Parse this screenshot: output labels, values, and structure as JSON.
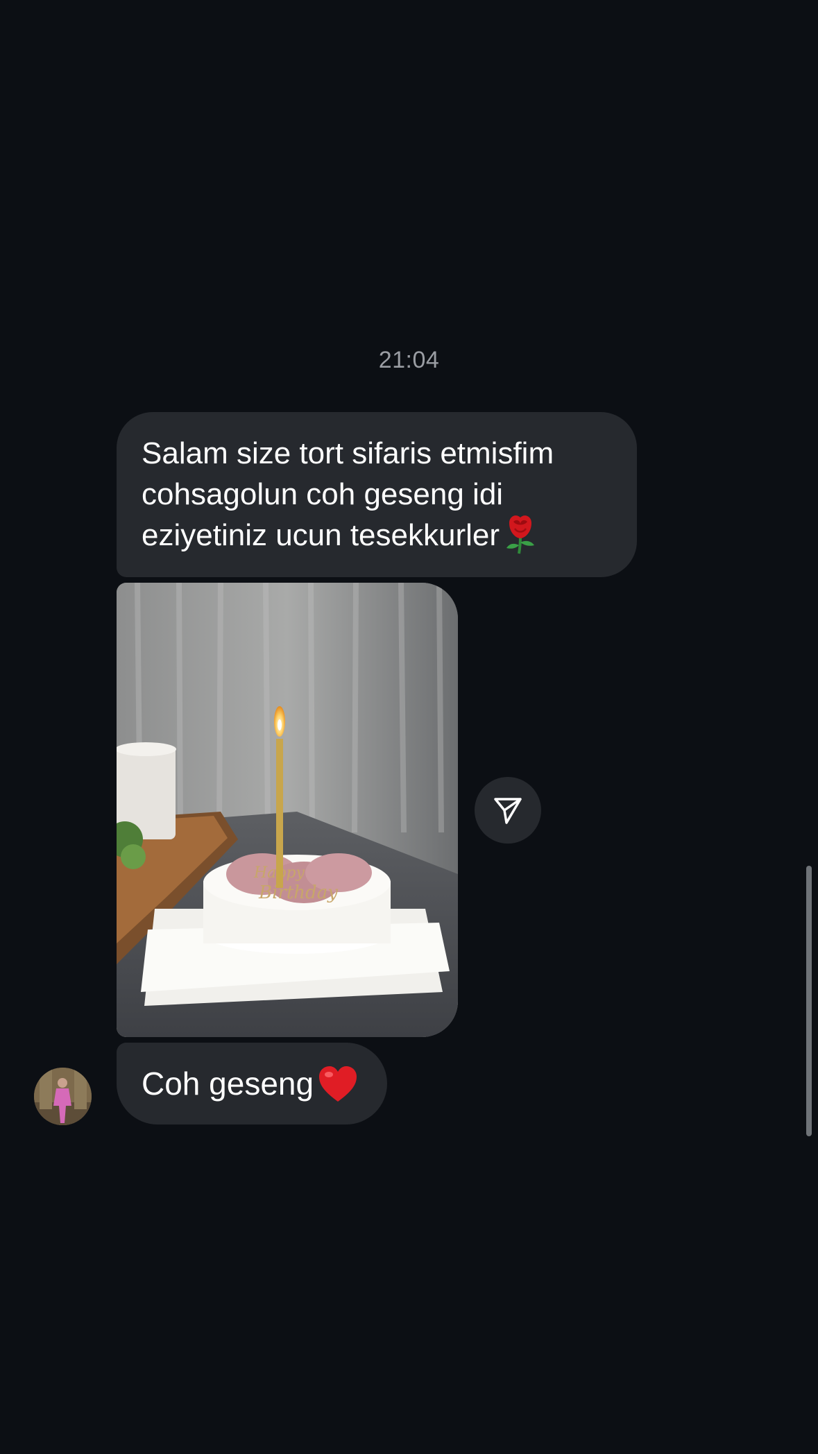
{
  "thread": {
    "timestamp": "21:04",
    "messages": [
      {
        "lines": [
          "Salam size tort sifaris etmisfim",
          "cohsagolun coh geseng idi",
          "eziyetiniz ucun tesekkurler"
        ],
        "trailing_emoji": "rose-icon"
      },
      {
        "photo_description_icon": "cake-photo"
      },
      {
        "text": "Coh geseng",
        "trailing_emoji": "heart-icon"
      }
    ]
  },
  "actions": {
    "share_icon": "send-icon"
  },
  "colors": {
    "background": "#0c0f14",
    "bubble": "#26292e",
    "timestamp": "#9a9da3",
    "text": "#ffffff"
  }
}
